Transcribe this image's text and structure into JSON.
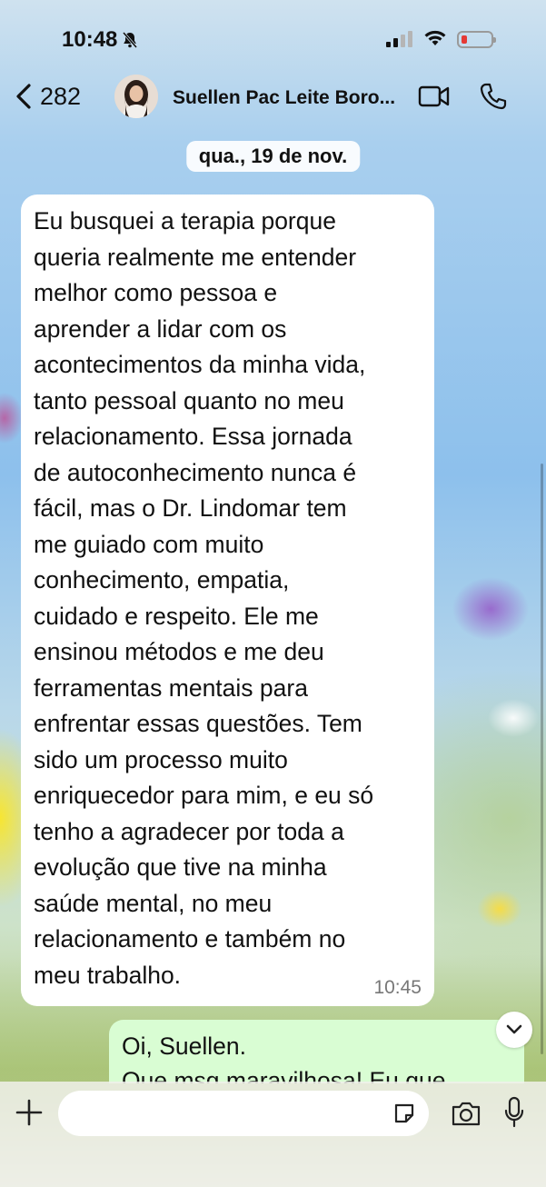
{
  "status_bar": {
    "time": "10:48",
    "icons": [
      "bell-off-icon",
      "signal-icon",
      "wifi-icon",
      "battery-low-icon"
    ]
  },
  "header": {
    "back_count": "282",
    "contact_name": "Suellen Pac Leite Boro...",
    "icons": [
      "back-chevron-icon",
      "video-call-icon",
      "phone-icon"
    ]
  },
  "chat": {
    "date_label": "qua., 19 de nov.",
    "incoming": {
      "text": "Eu busquei a terapia porque\nqueria realmente me entender\nmelhor como pessoa e\naprender a lidar com os\nacontecimentos da minha vida,\ntanto pessoal quanto no meu\nrelacionamento. Essa jornada\nde autoconhecimento nunca é\nfácil, mas o Dr. Lindomar tem\nme guiado com muito\nconhecimento, empatia,\ncuidado e respeito. Ele me\nensinou métodos e me deu\nferramentas mentais para\nenfrentar essas questões. Tem\nsido um processo muito\nenriquecedor para mim, e eu só\ntenho a agradecer por toda a\nevolução que tive na minha\nsaúde mental, no meu\nrelacionamento e também no\nmeu trabalho.",
      "time": "10:45"
    },
    "outgoing": {
      "text": "Oi, Suellen.\nQue msg maravilhosa! Eu que"
    }
  },
  "composer": {
    "placeholder": "",
    "icons": [
      "plus-icon",
      "sticker-icon",
      "camera-icon",
      "microphone-icon"
    ]
  },
  "colors": {
    "incoming_bubble": "#ffffff",
    "outgoing_bubble": "#d9fdd3",
    "battery_low": "#e53935"
  }
}
